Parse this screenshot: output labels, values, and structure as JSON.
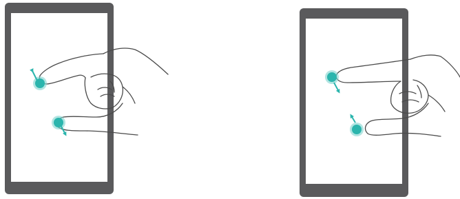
{
  "colors": {
    "device_frame": "#5a5a5c",
    "screen": "#ffffff",
    "touch_point": "#2bb5ad",
    "touch_point_rim": "#7fd3ce",
    "arrow": "#2bb5ad",
    "hand_outline": "#4a4a4a",
    "hand_fill": "#ffffff"
  },
  "illustrations": [
    {
      "name": "pinch-out-gesture",
      "device": "tablet",
      "fingers": [
        {
          "arrow_direction": "up-left"
        },
        {
          "arrow_direction": "down-right"
        }
      ]
    },
    {
      "name": "pinch-in-gesture",
      "device": "tablet",
      "fingers": [
        {
          "arrow_direction": "down-right"
        },
        {
          "arrow_direction": "up-left"
        }
      ]
    }
  ]
}
